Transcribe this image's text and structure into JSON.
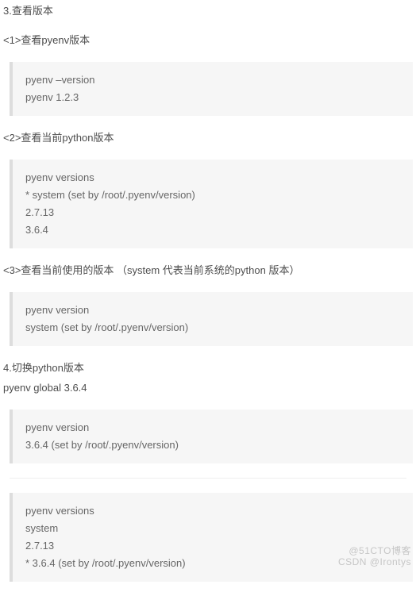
{
  "sections": {
    "s3_title": "3.查看版本",
    "s3_sub1": "<1>查看pyenv版本",
    "s3_sub2": "<2>查看当前python版本",
    "s3_sub3": "<3>查看当前使用的版本 （system 代表当前系统的python 版本）",
    "s4_title": "4.切换python版本",
    "s4_cmd": "pyenv global 3.6.4"
  },
  "code1": {
    "l1": "pyenv –version",
    "l2": "pyenv 1.2.3"
  },
  "code2": {
    "l1": "pyenv versions",
    "l2": "* system (set by /root/.pyenv/version)",
    "l3": "2.7.13",
    "l4": "3.6.4"
  },
  "code3": {
    "l1": "pyenv version",
    "l2": "system (set by /root/.pyenv/version)"
  },
  "code4": {
    "l1": "pyenv version",
    "l2": "3.6.4 (set by /root/.pyenv/version)"
  },
  "code5": {
    "l1": "pyenv versions",
    "l2": "system",
    "l3": "2.7.13",
    "l4": "* 3.6.4 (set by /root/.pyenv/version)"
  },
  "watermark": {
    "line1": "@51CTO博客",
    "line2": "CSDN @Irontys"
  }
}
